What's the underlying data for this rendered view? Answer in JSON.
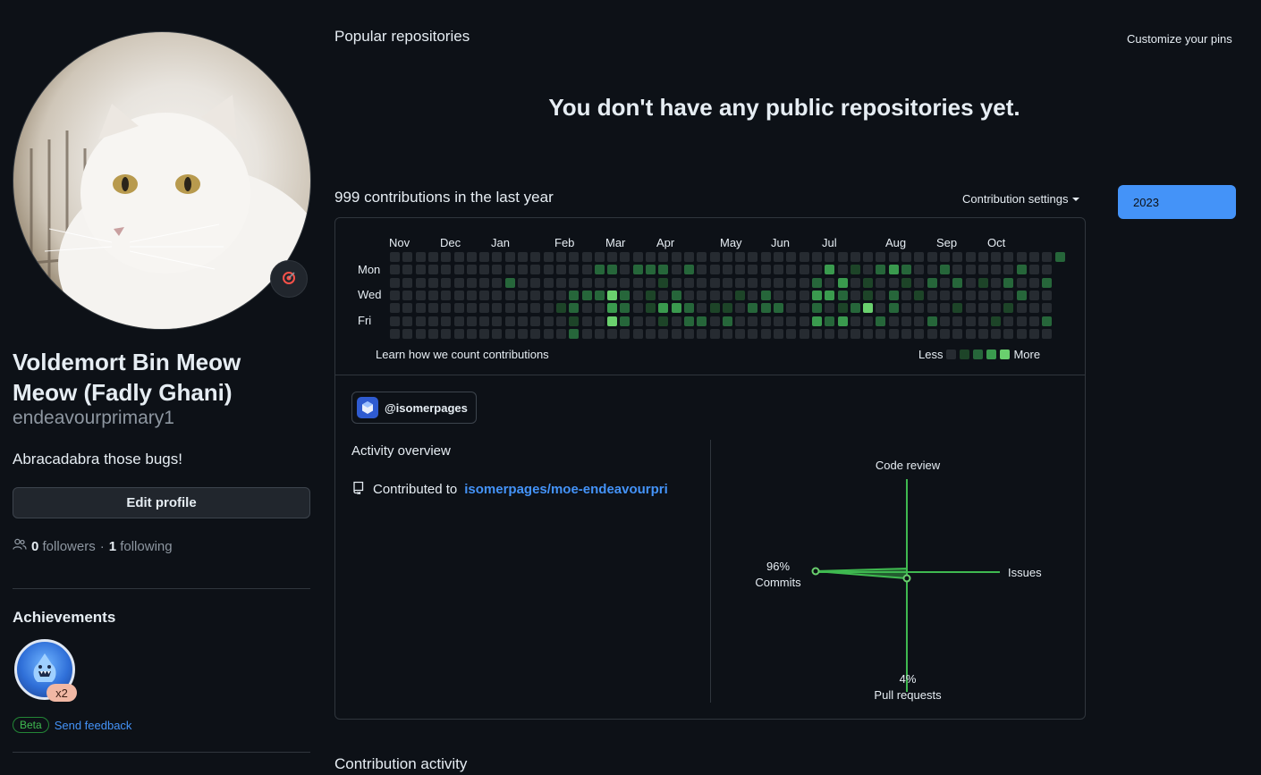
{
  "profile": {
    "full_name": "Voldemort Bin Meow Meow (Fadly Ghani)",
    "username": "endeavourprimary1",
    "bio": "Abracadabra those bugs!",
    "edit_label": "Edit profile",
    "followers_count": "0",
    "followers_label": "followers",
    "separator": "·",
    "following_count": "1",
    "following_label": "following",
    "status_icon": "target-icon"
  },
  "achievements": {
    "title": "Achievements",
    "badge_icon": "shark-badge-icon",
    "badge_count": "x2",
    "beta_label": "Beta",
    "feedback_label": "Send feedback"
  },
  "popular": {
    "title": "Popular repositories",
    "customize_label": "Customize your pins",
    "empty_message": "You don't have any public repositories yet."
  },
  "contributions": {
    "summary": "999 contributions in the last year",
    "settings_label": "Contribution settings",
    "year": "2023",
    "months": [
      "Nov",
      "Dec",
      "Jan",
      "Feb",
      "Mar",
      "Apr",
      "May",
      "Jun",
      "Jul",
      "Aug",
      "Sep",
      "Oct"
    ],
    "days": [
      "Mon",
      "Wed",
      "Fri"
    ],
    "learn_label": "Learn how we count contributions",
    "legend_less": "Less",
    "legend_more": "More",
    "colors": {
      "empty": "#262b31",
      "level1": "#1d4428",
      "level2": "#26663a",
      "level3": "#3a9a4e",
      "level4": "#6ad06e"
    }
  },
  "activity": {
    "org_label": "@isomerpages",
    "overview_title": "Activity overview",
    "contributed_prefix": "Contributed to",
    "contributed_repo": "isomerpages/moe-endeavourpri",
    "code_review_label": "Code review",
    "issues_label": "Issues",
    "commits_pct": "96%",
    "commits_label": "Commits",
    "pr_pct": "4%",
    "pr_label": "Pull requests"
  },
  "contribution_activity_title": "Contribution activity"
}
